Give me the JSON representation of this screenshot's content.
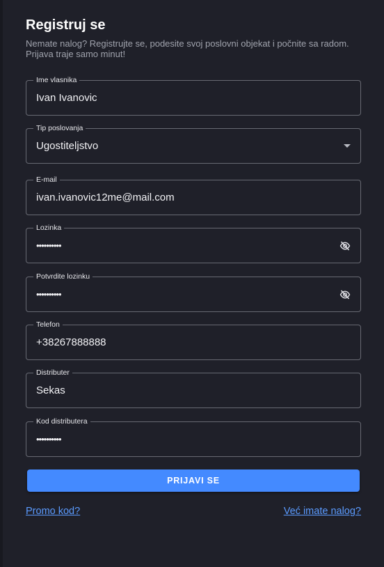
{
  "header": {
    "title": "Registruj se",
    "subtitle_line1": "Nemate nalog? Registrujte se, podesite svoj poslovni objekat i počnite sa radom.",
    "subtitle_line2": "Prijava traje samo minut!"
  },
  "fields": {
    "owner_name": {
      "label": "Ime vlasnika",
      "value": "Ivan Ivanovic"
    },
    "business_type": {
      "label": "Tip poslovanja",
      "value": "Ugostiteljstvo",
      "icon": "caret-down-icon"
    },
    "email": {
      "label": "E-mail",
      "value": "ivan.ivanovic12me@mail.com"
    },
    "password": {
      "label": "Lozinka",
      "value": "••••••••••",
      "icon": "eye-off-icon"
    },
    "confirm_password": {
      "label": "Potvrdite lozinku",
      "value": "••••••••••",
      "icon": "eye-off-icon"
    },
    "phone": {
      "label": "Telefon",
      "value": "+38267888888"
    },
    "distributor": {
      "label": "Distributer",
      "value": "Sekas"
    },
    "distributor_code": {
      "label": "Kod distributera",
      "value": "••••••••••"
    }
  },
  "actions": {
    "submit_label": "PRIJAVI SE",
    "promo_link": "Promo kod?",
    "login_link": "Već imate nalog?"
  },
  "colors": {
    "background": "#1f2029",
    "accent": "#448aff",
    "link": "#5b9bff",
    "border": "#686a73"
  }
}
